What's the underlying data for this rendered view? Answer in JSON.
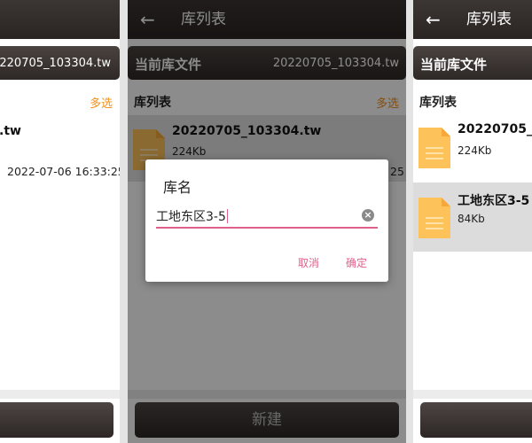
{
  "left": {
    "current_lib_value": "20220705_103304.tw",
    "multi_select": "多选",
    "item": {
      "name_tail": ".tw",
      "time": "2022-07-06 16:33:25"
    }
  },
  "mid": {
    "back_icon": "←",
    "title": "库列表",
    "current_lib_label": "当前库文件",
    "current_lib_value": "20220705_103304.tw",
    "section_label": "库列表",
    "multi_select": "多选",
    "item": {
      "name": "20220705_103304.tw",
      "size": "224Kb",
      "time_tail": "25"
    },
    "new_button": "新建",
    "dialog": {
      "title": "库名",
      "input_value": "工地东区3-5",
      "clear_icon": "×",
      "cancel": "取消",
      "confirm": "确定"
    }
  },
  "right": {
    "back_icon": "←",
    "title": "库列表",
    "current_lib_label": "当前库文件",
    "section_label": "库列表",
    "items": [
      {
        "name": "20220705_1",
        "size": "224Kb"
      },
      {
        "name": "工地东区3-5",
        "size": "84Kb"
      }
    ]
  },
  "colors": {
    "accent_orange": "#f0901c",
    "dialog_accent": "#e0608a",
    "appbar_dark": "#2a2422",
    "file_icon": "#fdc25a",
    "selected_row": "#dcdcdc"
  }
}
